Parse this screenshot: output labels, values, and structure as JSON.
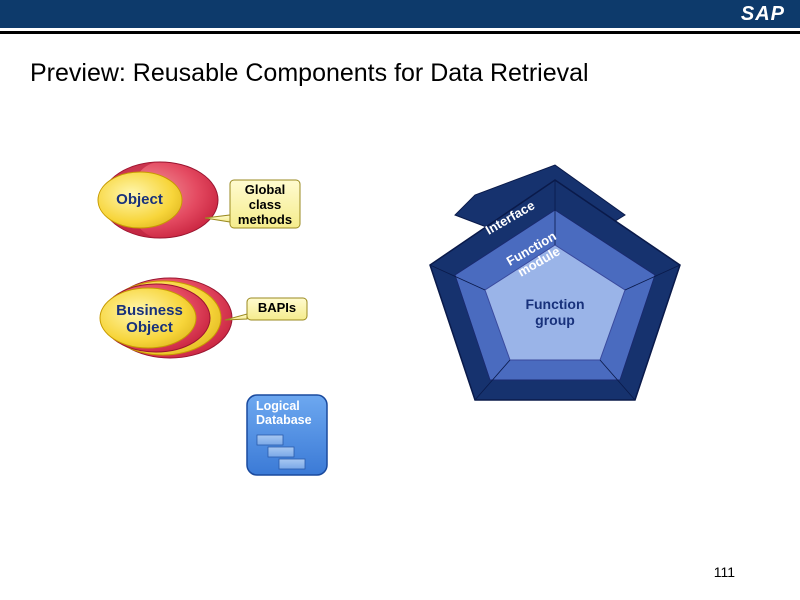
{
  "header": {
    "logo": "SAP"
  },
  "title": "Preview:  Reusable Components for Data Retrieval",
  "page_number": "111",
  "diagram": {
    "obj1": {
      "label": "Object",
      "callout": "Global\nclass\nmethods"
    },
    "obj2": {
      "label": "Business\nObject",
      "callout": "BAPIs"
    },
    "ldb": {
      "label": "Logical\nDatabase"
    },
    "pentagon": {
      "core": "Function\ngroup",
      "mid": "Function\nmodule",
      "outer": "Interface"
    }
  }
}
